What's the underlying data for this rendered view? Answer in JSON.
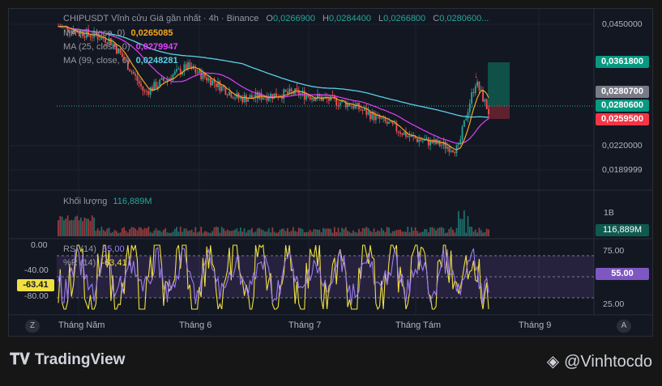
{
  "legend": {
    "title": "CHIPUSDT Vĩnh cửu Giá gần nhất · 4h · Binance",
    "ohlc": {
      "o_label": "O",
      "o": "0,0266900",
      "h_label": "H",
      "h": "0,0284400",
      "l_label": "L",
      "l": "0,0266800",
      "c_label": "C",
      "c": "0,0280600..."
    },
    "ma7": {
      "label": "MA (7, close, 0)",
      "value": "0,0265085",
      "color": "#f5a623"
    },
    "ma25": {
      "label": "MA (25, close, 0)",
      "value": "0,0279947",
      "color": "#e040fb"
    },
    "ma99": {
      "label": "MA (99, close, 0)",
      "value": "0,0248281",
      "color": "#5ad1e4"
    },
    "volume": {
      "label": "Khối lượng",
      "value": "116,889M",
      "color": "#26a69a"
    },
    "rsi": {
      "label": "RSI (14)",
      "value": "55,00",
      "color": "#9c7cf0"
    },
    "wr": {
      "label": "%R (14)",
      "value": "-63,41",
      "color": "#f0e040"
    }
  },
  "price_axis": {
    "ticks": [
      "0,0450000",
      "0,0220000",
      "0,0189999"
    ],
    "tags": [
      {
        "value": "0,0361800",
        "bg": "#089981"
      },
      {
        "value": "0,0280700",
        "bg": "#787b86"
      },
      {
        "value": "0,0280600",
        "bg": "#089981"
      },
      {
        "value": "0,0259500",
        "bg": "#f23645"
      }
    ]
  },
  "volume_axis": {
    "tick": "1B",
    "tag": "116,889M"
  },
  "osc_axis": {
    "right_ticks": [
      "75.00",
      "25.00"
    ],
    "right_tag": "55.00",
    "left_ticks": [
      "0.00",
      "-40.00",
      "-80.00"
    ],
    "left_tag": "-63.41"
  },
  "time_axis": {
    "labels": [
      "Tháng Năm",
      "Tháng 6",
      "Tháng 7",
      "Tháng Tám",
      "Tháng 9"
    ]
  },
  "buttons": {
    "zoom_left": "Z",
    "auto_right": "A"
  },
  "brand": {
    "name": "TradingView",
    "author": "@Vinhtocdo"
  },
  "colors": {
    "up": "#26a69a",
    "down": "#ef5350",
    "bg": "#131722",
    "grid": "#1f2330"
  },
  "chart_data": {
    "type": "line",
    "x": [
      "Tháng Năm",
      "Tháng 6",
      "Tháng 7",
      "Tháng Tám",
      "Tháng 9"
    ],
    "series": [
      {
        "name": "MA (7, close, 0)",
        "values": [
          0.0442,
          0.032,
          0.031,
          0.0232,
          0.0265
        ]
      },
      {
        "name": "MA (25, close, 0)",
        "values": [
          0.044,
          0.034,
          0.0315,
          0.024,
          0.028
        ]
      },
      {
        "name": "MA (99, close, 0)",
        "values": [
          0.046,
          0.035,
          0.03,
          0.0265,
          0.0248
        ]
      }
    ],
    "ylim": [
      0.0185,
      0.046
    ]
  }
}
